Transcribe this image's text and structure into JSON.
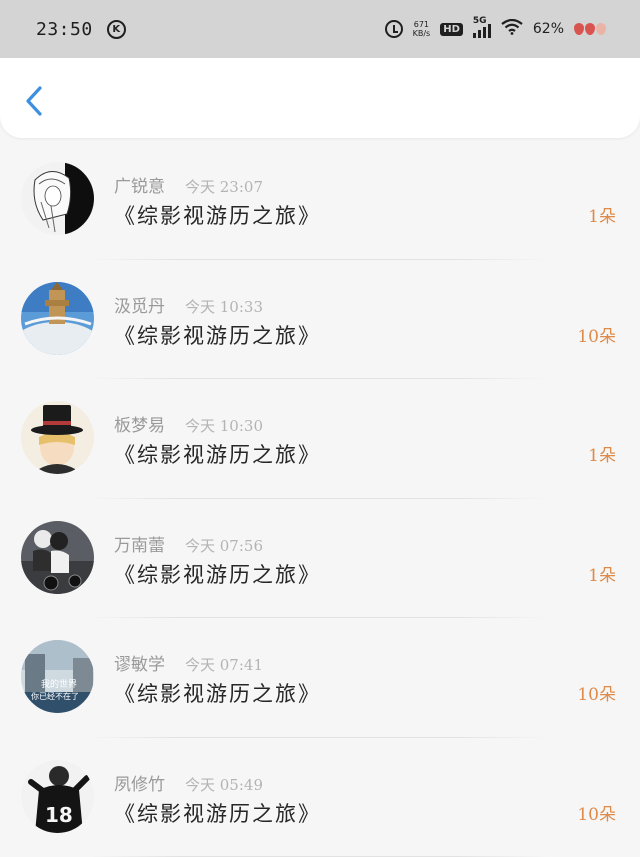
{
  "status": {
    "time": "23:50",
    "k_badge": "K",
    "speed_value": "671",
    "speed_unit": "KB/s",
    "hd": "HD",
    "network": "5G",
    "battery": "62%"
  },
  "colors": {
    "accent": "#3d8fe0",
    "amount": "#de8a4a"
  },
  "list": [
    {
      "name": "广锐意",
      "time": "今天 23:07",
      "book": "《综影视游历之旅》",
      "amount": "1朵",
      "avatar": "anime-girl-avatar"
    },
    {
      "name": "汲觅丹",
      "time": "今天 10:33",
      "book": "《综影视游历之旅》",
      "amount": "10朵",
      "avatar": "castle-fisheye-avatar"
    },
    {
      "name": "板梦易",
      "time": "今天 10:30",
      "book": "《综影视游历之旅》",
      "amount": "1朵",
      "avatar": "top-hat-boy-avatar"
    },
    {
      "name": "万南蕾",
      "time": "今天 07:56",
      "book": "《综影视游历之旅》",
      "amount": "1朵",
      "avatar": "motorcycle-couple-avatar"
    },
    {
      "name": "谬敏学",
      "time": "今天 07:41",
      "book": "《综影视游历之旅》",
      "amount": "10朵",
      "avatar": "my-world-avatar",
      "avatar_text": [
        "我的世界",
        "你已经不在了"
      ]
    },
    {
      "name": "夙修竹",
      "time": "今天 05:49",
      "book": "《综影视游历之旅》",
      "amount": "10朵",
      "avatar": "jersey-18-avatar",
      "avatar_text": [
        "18"
      ]
    }
  ]
}
